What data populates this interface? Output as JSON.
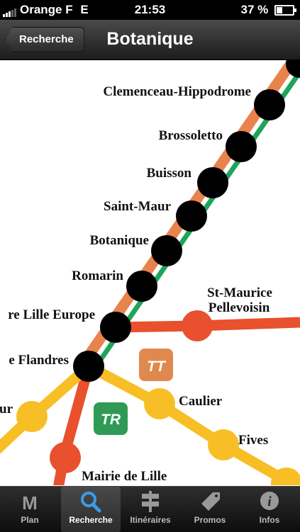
{
  "status": {
    "carrier": "Orange F",
    "network": "E",
    "time": "21:53",
    "battery": "37 %",
    "battery_level": 0.37
  },
  "navbar": {
    "back_label": "Recherche",
    "title": "Botanique"
  },
  "map": {
    "stations": [
      "Clemenceau-Hippodrome",
      "Brossoletto",
      "Buisson",
      "Saint-Maur",
      "Botanique",
      "Romarin",
      "re Lille Europe",
      "e Flandres",
      "ur",
      "Caulier",
      "Fives",
      "Mairie de Lille"
    ],
    "st_maurice": [
      "St-Maurice",
      "Pellevoisin"
    ],
    "badge_tt": "TT",
    "badge_tr": "TR",
    "colors": {
      "orange_line": "#E8834E",
      "green_line": "#1FA45A",
      "red_line": "#E8502E",
      "yellow_line": "#F7BE26",
      "tt_badge": "#E0894F",
      "tr_badge": "#2E9A55"
    }
  },
  "tabs": [
    {
      "label": "Plan",
      "icon": "metro-m-icon"
    },
    {
      "label": "Recherche",
      "icon": "search-icon"
    },
    {
      "label": "Itinéraires",
      "icon": "signpost-icon"
    },
    {
      "label": "Promos",
      "icon": "tag-icon"
    },
    {
      "label": "Infos",
      "icon": "info-icon"
    }
  ]
}
